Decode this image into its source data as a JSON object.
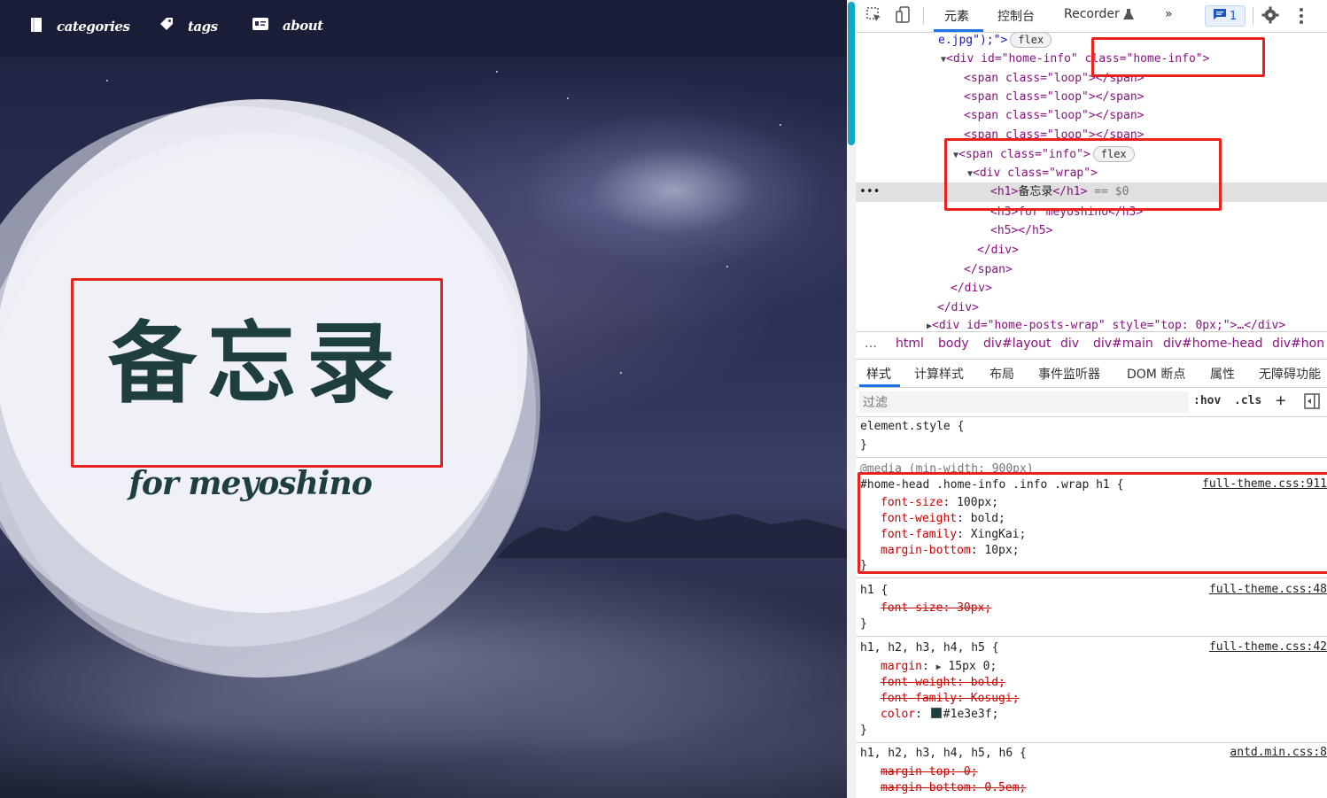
{
  "nav": {
    "items": [
      {
        "label": "categories",
        "icon": "book-icon"
      },
      {
        "label": "tags",
        "icon": "tag-icon"
      },
      {
        "label": "about",
        "icon": "id-card-icon"
      }
    ]
  },
  "hero": {
    "title": "备忘录",
    "subtitle": "for meyoshino"
  },
  "devtools": {
    "toolbar": {
      "tabs": [
        "元素",
        "控制台",
        "Recorder",
        "»"
      ],
      "issues_count": "1"
    },
    "dom": {
      "line0_text": "e.jpg\");\">",
      "line0_pill": "flex",
      "home_info_open": "<div id=\"home-info\" class=\"home-info\">",
      "loop_span": "<span class=\"loop\"></span>",
      "info_span": "<span class=\"info\">",
      "info_pill": "flex",
      "wrap_div": "<div class=\"wrap\">",
      "h1_tag": "<h1>",
      "h1_text": "备忘录",
      "h1_close": "</h1>",
      "h1_suffix": " == $0",
      "h3_line": "<h3>for meyoshino</h3>",
      "h5_line": "<h5></h5>",
      "div_close": "</div>",
      "span_close": "</span>",
      "posts_wrap": "<div id=\"home-posts-wrap\" style=\"top: 0px;\">…</div>",
      "ellipsis": "…"
    },
    "breadcrumbs": [
      "…",
      "html",
      "body",
      "div#layout",
      "div",
      "div#main",
      "div#home-head",
      "div#hon"
    ],
    "sub_tabs": [
      "样式",
      "计算样式",
      "布局",
      "事件监听器",
      "DOM 断点",
      "属性",
      "无障碍功能"
    ],
    "filter": {
      "placeholder": "过滤",
      "hov": ":hov",
      "cls": ".cls",
      "add": "+"
    },
    "styles": {
      "element_style": "element.style {",
      "close_brace": "}",
      "media": "@media (min-width: 900px)",
      "rule1_selector": "#home-head .home-info .info .wrap h1 {",
      "rule1_source": "full-theme.css:911",
      "rule1_props": [
        {
          "name": "font-size",
          "value": "100px;"
        },
        {
          "name": "font-weight",
          "value": "bold;"
        },
        {
          "name": "font-family",
          "value": "XingKai;"
        },
        {
          "name": "margin-bottom",
          "value": "10px;"
        }
      ],
      "rule2_selector": "h1 {",
      "rule2_source": "full-theme.css:48",
      "rule2_prop": "font-size: 30px;",
      "rule3_selector": "h1, h2, h3, h4, h5 {",
      "rule3_source": "full-theme.css:42",
      "rule3_margin_name": "margin",
      "rule3_margin_value": "15px 0;",
      "rule3_fw": "font-weight: bold;",
      "rule3_ff": "font-family: Kosugi;",
      "rule3_color_name": "color",
      "rule3_color_value": "#1e3e3f;",
      "rule4_selector": "h1, h2, h3, h4, h5, h6 {",
      "rule4_source": "antd.min.css:8",
      "rule4_mt": "margin-top: 0;",
      "rule4_mb": "margin-bottom: 0.5em;"
    }
  },
  "colors": {
    "title": "#1e3e3f",
    "highlight_box": "#e8231f",
    "scroll_thumb": "#11a9c4",
    "accent": "#1a73e8"
  }
}
